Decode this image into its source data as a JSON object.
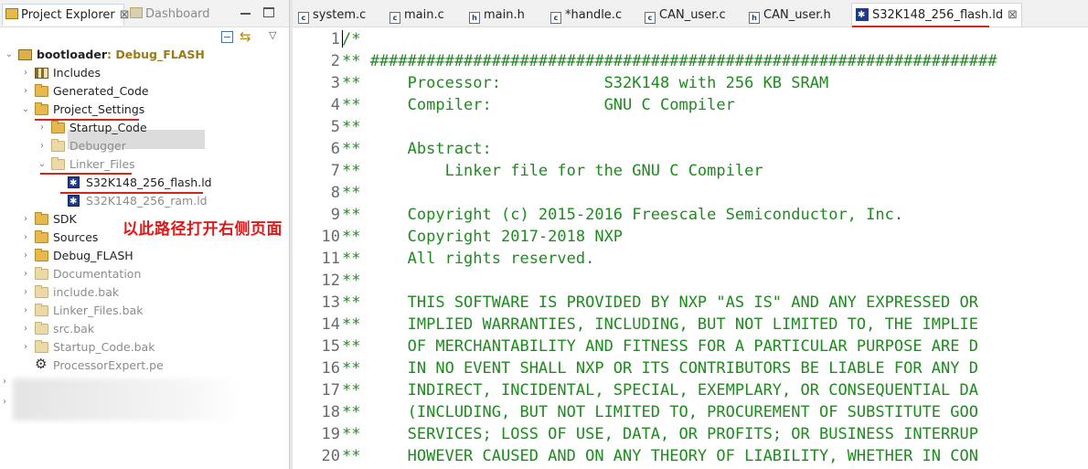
{
  "explorer": {
    "tab_title": "Project Explorer",
    "tab_close": "⊠",
    "dashboard_tab": "Dashboard",
    "tree": [
      {
        "label": "bootloader",
        "suffix": ": Debug_FLASH",
        "depth": 0,
        "twisty": "⌄",
        "icon": "project-icon",
        "style": "bold"
      },
      {
        "label": "Includes",
        "depth": 1,
        "twisty": "›",
        "icon": "includes-icon",
        "style": "normal"
      },
      {
        "label": "Generated_Code",
        "depth": 1,
        "twisty": "›",
        "icon": "folder-icon",
        "style": "normal"
      },
      {
        "label": "Project_Settings",
        "depth": 1,
        "twisty": "⌄",
        "icon": "folder-icon",
        "style": "normal"
      },
      {
        "label": "Startup_Code",
        "depth": 2,
        "twisty": "›",
        "icon": "folder-icon",
        "style": "normal"
      },
      {
        "label": "Debugger",
        "depth": 2,
        "twisty": "›",
        "icon": "folder-icon",
        "style": "dim"
      },
      {
        "label": "Linker_Files",
        "depth": 2,
        "twisty": "⌄",
        "icon": "folder-icon",
        "style": "dim"
      },
      {
        "label": "S32K148_256_flash.ld",
        "depth": 3,
        "twisty": "",
        "icon": "linker-file-icon",
        "style": "normal"
      },
      {
        "label": "S32K148_256_ram.ld",
        "depth": 3,
        "twisty": "",
        "icon": "linker-file-icon",
        "style": "dim"
      },
      {
        "label": "SDK",
        "depth": 1,
        "twisty": "›",
        "icon": "folder-icon",
        "style": "normal"
      },
      {
        "label": "Sources",
        "depth": 1,
        "twisty": "›",
        "icon": "folder-icon",
        "style": "normal"
      },
      {
        "label": "Debug_FLASH",
        "depth": 1,
        "twisty": "›",
        "icon": "folder-icon",
        "style": "normal"
      },
      {
        "label": "Documentation",
        "depth": 1,
        "twisty": "›",
        "icon": "folder-icon",
        "style": "dim"
      },
      {
        "label": "include.bak",
        "depth": 1,
        "twisty": "›",
        "icon": "folder-icon",
        "style": "dim"
      },
      {
        "label": "Linker_Files.bak",
        "depth": 1,
        "twisty": "›",
        "icon": "folder-icon",
        "style": "dim"
      },
      {
        "label": "src.bak",
        "depth": 1,
        "twisty": "›",
        "icon": "folder-icon",
        "style": "dim"
      },
      {
        "label": "Startup_Code.bak",
        "depth": 1,
        "twisty": "›",
        "icon": "folder-icon",
        "style": "dim"
      },
      {
        "label": "ProcessorExpert.pe",
        "depth": 1,
        "twisty": "",
        "icon": "processor-expert-icon",
        "style": "dim"
      }
    ],
    "annotation": "以此路径打开右侧页面",
    "blurred_twisty": "›"
  },
  "editor": {
    "tabs": [
      {
        "label": "system.c",
        "icon": "c"
      },
      {
        "label": "main.c",
        "icon": "c"
      },
      {
        "label": "main.h",
        "icon": "h"
      },
      {
        "label": "*handle.c",
        "icon": "c"
      },
      {
        "label": "CAN_user.c",
        "icon": "c"
      },
      {
        "label": "CAN_user.h",
        "icon": "h"
      },
      {
        "label": "S32K148_256_flash.ld",
        "icon": "ld",
        "active": true
      }
    ],
    "active_close": "⊠",
    "lines": [
      {
        "n": "1",
        "text": "/*"
      },
      {
        "n": "2",
        "text": "** ###################################################################"
      },
      {
        "n": "3",
        "text": "**     Processor:           S32K148 with 256 KB SRAM"
      },
      {
        "n": "4",
        "text": "**     Compiler:            GNU C Compiler"
      },
      {
        "n": "5",
        "text": "**"
      },
      {
        "n": "6",
        "text": "**     Abstract:"
      },
      {
        "n": "7",
        "text": "**         Linker file for the GNU C Compiler"
      },
      {
        "n": "8",
        "text": "**"
      },
      {
        "n": "9",
        "text": "**     Copyright (c) 2015-2016 Freescale Semiconductor, Inc."
      },
      {
        "n": "10",
        "text": "**     Copyright 2017-2018 NXP"
      },
      {
        "n": "11",
        "text": "**     All rights reserved."
      },
      {
        "n": "12",
        "text": "**"
      },
      {
        "n": "13",
        "text": "**     THIS SOFTWARE IS PROVIDED BY NXP \"AS IS\" AND ANY EXPRESSED OR"
      },
      {
        "n": "14",
        "text": "**     IMPLIED WARRANTIES, INCLUDING, BUT NOT LIMITED TO, THE IMPLIE"
      },
      {
        "n": "15",
        "text": "**     OF MERCHANTABILITY AND FITNESS FOR A PARTICULAR PURPOSE ARE D"
      },
      {
        "n": "16",
        "text": "**     IN NO EVENT SHALL NXP OR ITS CONTRIBUTORS BE LIABLE FOR ANY D"
      },
      {
        "n": "17",
        "text": "**     INDIRECT, INCIDENTAL, SPECIAL, EXEMPLARY, OR CONSEQUENTIAL DA"
      },
      {
        "n": "18",
        "text": "**     (INCLUDING, BUT NOT LIMITED TO, PROCUREMENT OF SUBSTITUTE GOO"
      },
      {
        "n": "19",
        "text": "**     SERVICES; LOSS OF USE, DATA, OR PROFITS; OR BUSINESS INTERRUP"
      },
      {
        "n": "20",
        "text": "**     HOWEVER CAUSED AND ON ANY THEORY OF LIABILITY, WHETHER IN CON"
      }
    ]
  },
  "colors": {
    "comment_green": "#1f8a1f",
    "annotation_red": "#e01818",
    "selection_gray": "#dcdcdc"
  }
}
